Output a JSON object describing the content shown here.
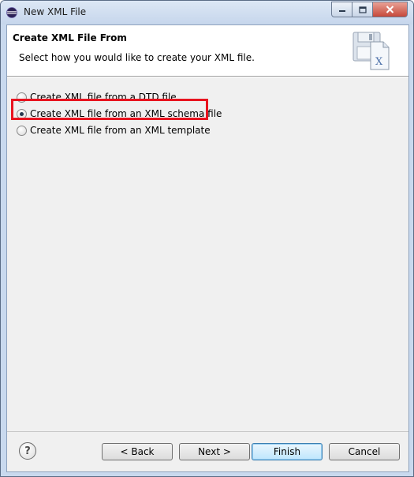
{
  "window": {
    "title": "New XML File"
  },
  "header": {
    "title": "Create XML File From",
    "description": "Select how you would like to create your XML file."
  },
  "options": [
    {
      "label": "Create XML file from a DTD file",
      "checked": false
    },
    {
      "label": "Create XML file from an XML schema file",
      "checked": true
    },
    {
      "label": "Create XML file from an XML template",
      "checked": false
    }
  ],
  "buttons": {
    "back": "< Back",
    "next": "Next >",
    "finish": "Finish",
    "cancel": "Cancel"
  },
  "highlight_color": "#e8131f"
}
